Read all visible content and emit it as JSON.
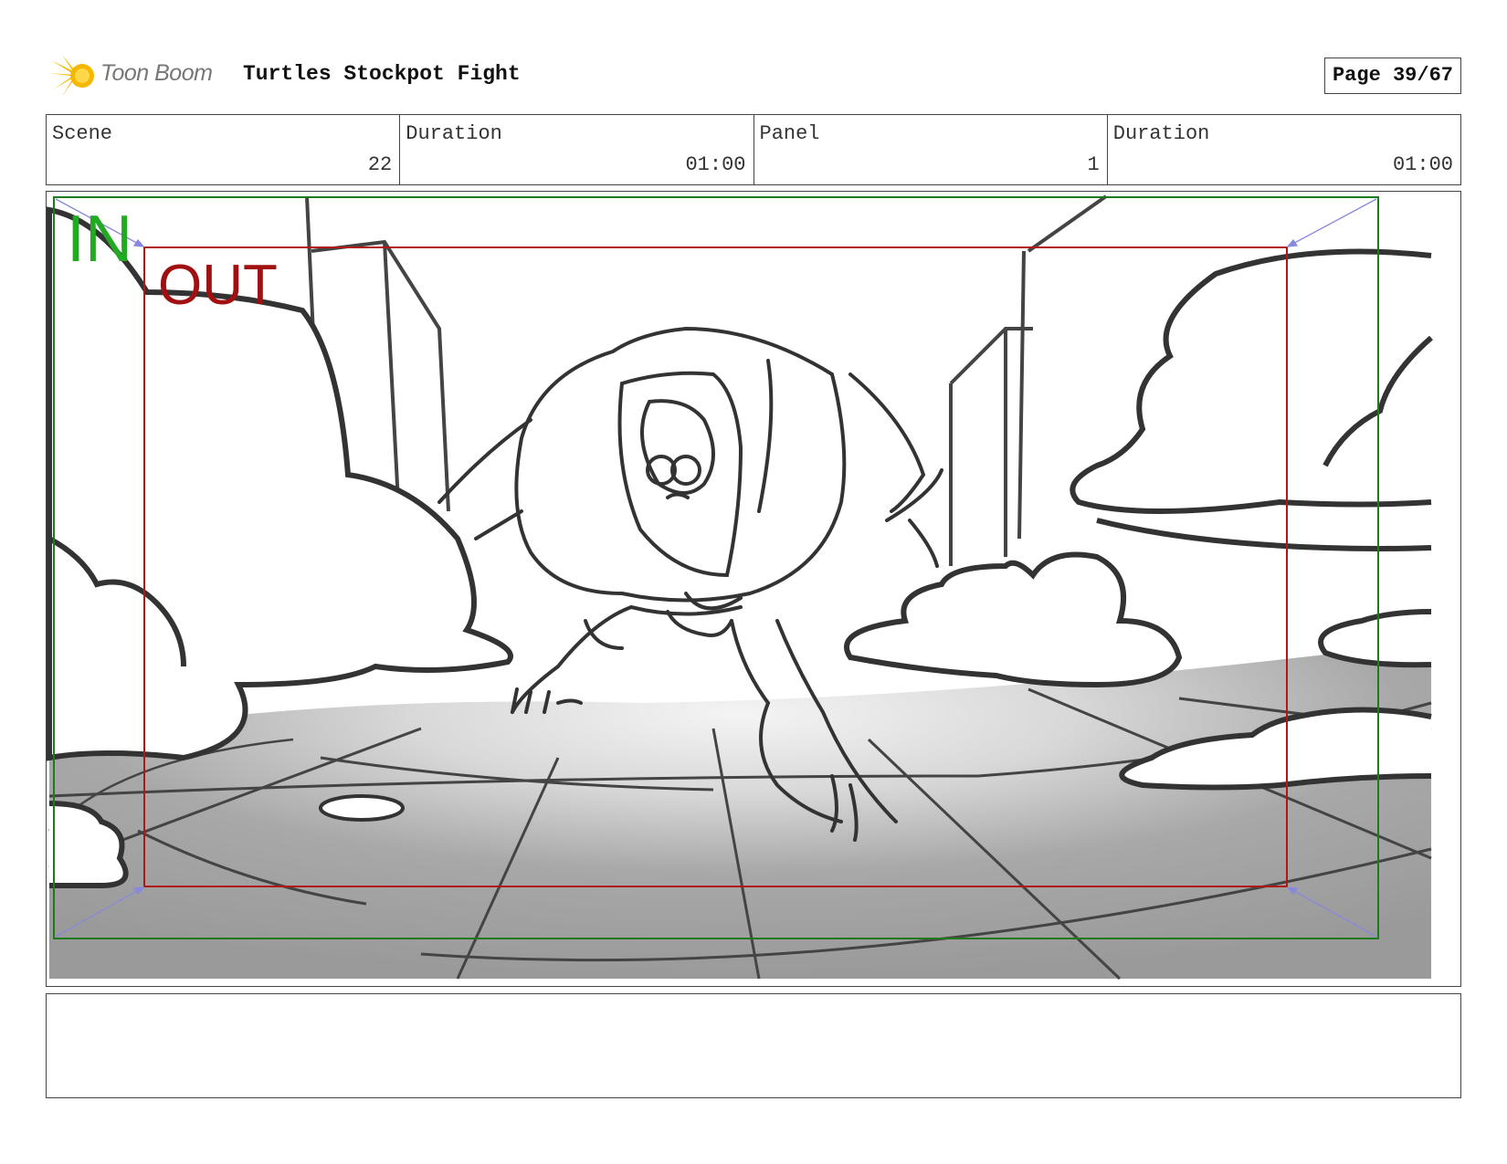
{
  "header": {
    "logo_text": "Toon Boom",
    "title": "Turtles Stockpot Fight",
    "page": "Page 39/67"
  },
  "info": [
    {
      "label": "Scene",
      "value": "22"
    },
    {
      "label": "Duration",
      "value": "01:00"
    },
    {
      "label": "Panel",
      "value": "1"
    },
    {
      "label": "Duration",
      "value": "01:00"
    }
  ],
  "panel": {
    "in_label": "IN",
    "out_label": "OUT"
  },
  "colors": {
    "in_frame": "#1f7a1f",
    "in_text": "#22aa22",
    "out_frame": "#b01818",
    "out_text": "#a01010",
    "logo_burst": "#f5b800"
  },
  "notes": ""
}
